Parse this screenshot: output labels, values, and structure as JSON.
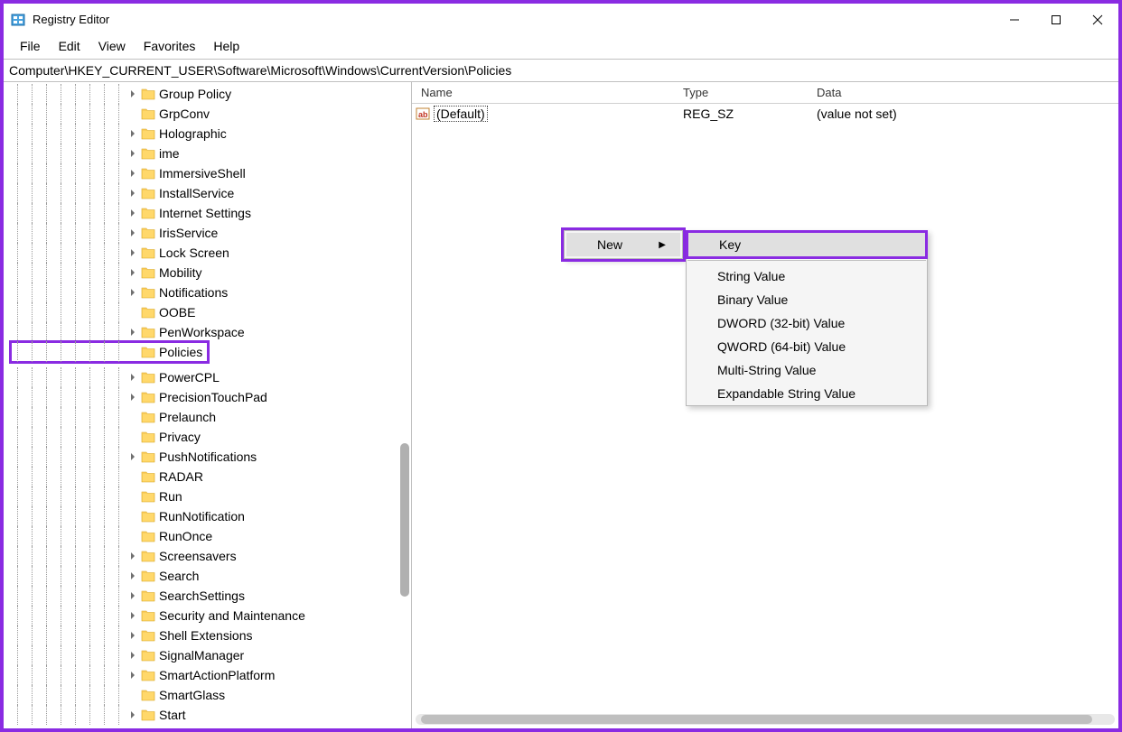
{
  "titlebar": {
    "title": "Registry Editor"
  },
  "menu": {
    "file": "File",
    "edit": "Edit",
    "view": "View",
    "favorites": "Favorites",
    "help": "Help"
  },
  "address": "Computer\\HKEY_CURRENT_USER\\Software\\Microsoft\\Windows\\CurrentVersion\\Policies",
  "tree": [
    {
      "label": "Group Policy",
      "exp": true
    },
    {
      "label": "GrpConv",
      "exp": false
    },
    {
      "label": "Holographic",
      "exp": true
    },
    {
      "label": "ime",
      "exp": true
    },
    {
      "label": "ImmersiveShell",
      "exp": true
    },
    {
      "label": "InstallService",
      "exp": true
    },
    {
      "label": "Internet Settings",
      "exp": true
    },
    {
      "label": "IrisService",
      "exp": true
    },
    {
      "label": "Lock Screen",
      "exp": true
    },
    {
      "label": "Mobility",
      "exp": true
    },
    {
      "label": "Notifications",
      "exp": true
    },
    {
      "label": "OOBE",
      "exp": false
    },
    {
      "label": "PenWorkspace",
      "exp": true
    },
    {
      "label": "Policies",
      "exp": false,
      "selected": true
    },
    {
      "label": "PowerCPL",
      "exp": true
    },
    {
      "label": "PrecisionTouchPad",
      "exp": true
    },
    {
      "label": "Prelaunch",
      "exp": false
    },
    {
      "label": "Privacy",
      "exp": false
    },
    {
      "label": "PushNotifications",
      "exp": true
    },
    {
      "label": "RADAR",
      "exp": false
    },
    {
      "label": "Run",
      "exp": false
    },
    {
      "label": "RunNotification",
      "exp": false
    },
    {
      "label": "RunOnce",
      "exp": false
    },
    {
      "label": "Screensavers",
      "exp": true
    },
    {
      "label": "Search",
      "exp": true
    },
    {
      "label": "SearchSettings",
      "exp": true
    },
    {
      "label": "Security and Maintenance",
      "exp": true
    },
    {
      "label": "Shell Extensions",
      "exp": true
    },
    {
      "label": "SignalManager",
      "exp": true
    },
    {
      "label": "SmartActionPlatform",
      "exp": true
    },
    {
      "label": "SmartGlass",
      "exp": false
    },
    {
      "label": "Start",
      "exp": true
    }
  ],
  "list": {
    "columns": {
      "name": "Name",
      "type": "Type",
      "data": "Data"
    },
    "rows": [
      {
        "name": "(Default)",
        "type": "REG_SZ",
        "data": "(value not set)"
      }
    ]
  },
  "context_primary": {
    "label": "New"
  },
  "context_sub": {
    "items": [
      {
        "label": "Key",
        "hovered": true
      },
      {
        "sep": true
      },
      {
        "label": "String Value"
      },
      {
        "label": "Binary Value"
      },
      {
        "label": "DWORD (32-bit) Value"
      },
      {
        "label": "QWORD (64-bit) Value"
      },
      {
        "label": "Multi-String Value"
      },
      {
        "label": "Expandable String Value"
      }
    ]
  }
}
